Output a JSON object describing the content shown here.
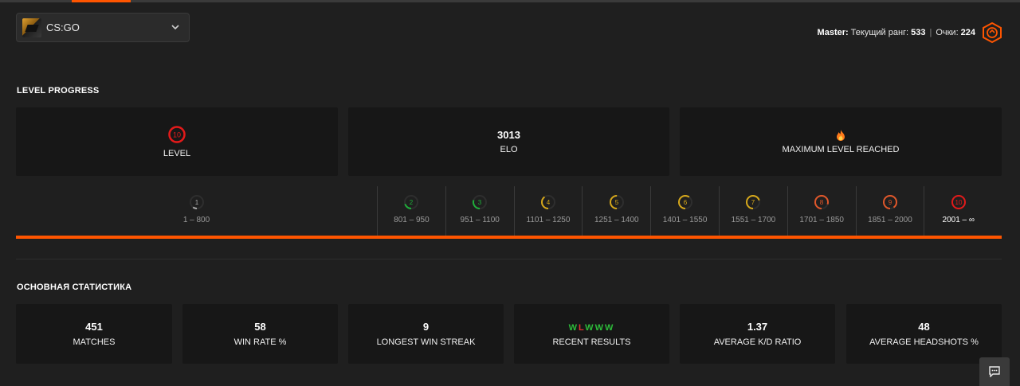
{
  "game_selector": {
    "label": "CS:GO"
  },
  "rank_info": {
    "tier": "Master:",
    "rank_label": "Текущий ранг:",
    "rank_value": "533",
    "separator": "|",
    "points_label": "Очки:",
    "points_value": "224"
  },
  "level_progress": {
    "title": "LEVEL PROGRESS",
    "cards": {
      "level": {
        "value": "10",
        "label": "LEVEL"
      },
      "elo": {
        "value": "3013",
        "label": "ELO"
      },
      "max": {
        "label": "MAXIMUM LEVEL REACHED"
      }
    },
    "levels": [
      {
        "level": "1",
        "range": "1 – 800",
        "color": "#aaaaaa",
        "fill": 0.1
      },
      {
        "level": "2",
        "range": "801 – 950",
        "color": "#1fae3a",
        "fill": 0.2
      },
      {
        "level": "3",
        "range": "951 – 1100",
        "color": "#1fae3a",
        "fill": 0.3
      },
      {
        "level": "4",
        "range": "1101 – 1250",
        "color": "#d6a81b",
        "fill": 0.4
      },
      {
        "level": "5",
        "range": "1251 – 1400",
        "color": "#d6a81b",
        "fill": 0.5
      },
      {
        "level": "6",
        "range": "1401 – 1550",
        "color": "#d6a81b",
        "fill": 0.6
      },
      {
        "level": "7",
        "range": "1551 – 1700",
        "color": "#d6a81b",
        "fill": 0.7
      },
      {
        "level": "8",
        "range": "1701 – 1850",
        "color": "#e0572a",
        "fill": 0.8
      },
      {
        "level": "9",
        "range": "1851 – 2000",
        "color": "#e0572a",
        "fill": 0.9
      },
      {
        "level": "10",
        "range": "2001 – ∞",
        "color": "#e21a1a",
        "fill": 1.0
      }
    ],
    "current_level": "10"
  },
  "main_stats": {
    "title": "ОСНОВНАЯ СТАТИСТИКА",
    "matches": {
      "value": "451",
      "label": "MATCHES"
    },
    "win_rate": {
      "value": "58",
      "label": "WIN RATE %"
    },
    "win_streak": {
      "value": "9",
      "label": "LONGEST WIN STREAK"
    },
    "recent": {
      "results": [
        "W",
        "L",
        "W",
        "W",
        "W"
      ],
      "label": "RECENT RESULTS"
    },
    "kd": {
      "value": "1.37",
      "label": "AVERAGE K/D RATIO"
    },
    "headshots": {
      "value": "48",
      "label": "AVERAGE HEADSHOTS %"
    }
  },
  "colors": {
    "accent": "#ff5500",
    "win": "#2dbd3a",
    "loss": "#e03131"
  },
  "icons": {
    "game": "csgo-icon",
    "dropdown": "chevron-down-icon",
    "rank": "master-rank-icon",
    "max_level": "fire-icon",
    "chat": "chat-icon"
  }
}
